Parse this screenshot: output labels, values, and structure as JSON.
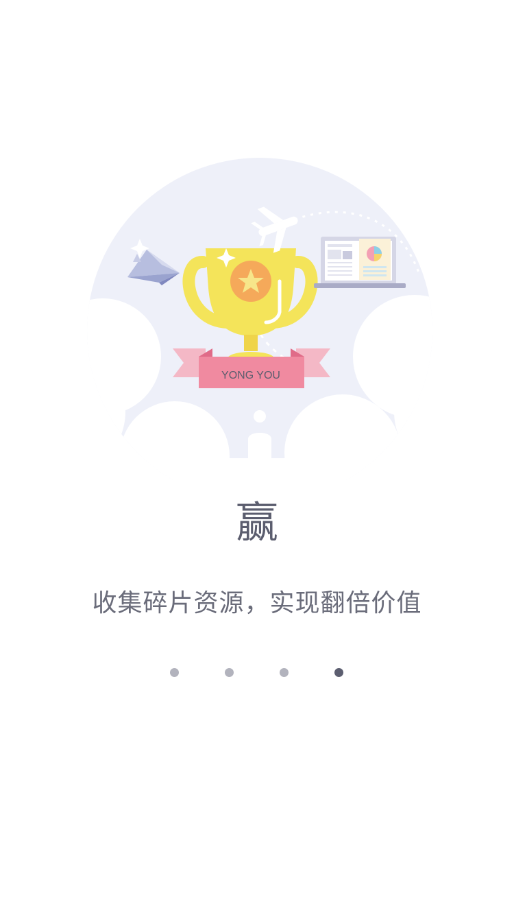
{
  "onboarding": {
    "title": "赢",
    "subtitle": "收集碎片资源，实现翻倍价值",
    "ribbon_text": "YONG YOU",
    "page_count": 4,
    "current_page": 4
  },
  "colors": {
    "background": "#ffffff",
    "bubble": "#eef0f9",
    "trophy": "#f4e45a",
    "trophy_medal": "#f5a95a",
    "ribbon": "#f08aa0",
    "ribbon_light": "#f4b8c6",
    "text_dark": "#5b5d6e",
    "dot_inactive": "#b2b3bd",
    "dot_active": "#5c5e70"
  },
  "icons": {
    "trophy": "trophy-icon",
    "airplane": "airplane-icon",
    "laptop": "laptop-icon",
    "paper_plane": "paper-plane-icon",
    "pawn": "pawn-icon"
  }
}
